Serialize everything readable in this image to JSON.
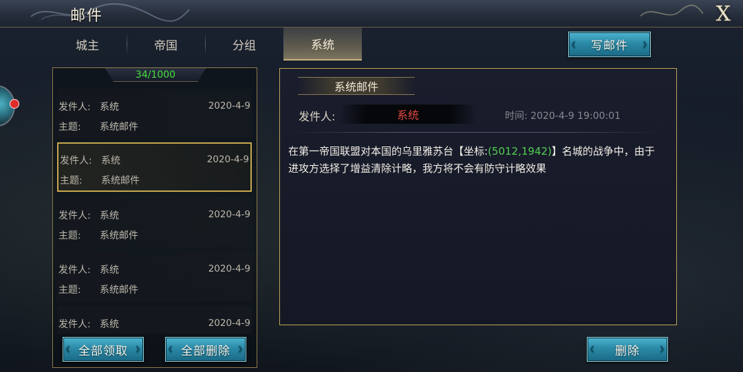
{
  "window": {
    "title": "邮件",
    "close_label": "X"
  },
  "tabs": [
    {
      "label": "城主",
      "active": false
    },
    {
      "label": "帝国",
      "active": false
    },
    {
      "label": "分组",
      "active": false
    },
    {
      "label": "系统",
      "active": true
    }
  ],
  "write_button": "写邮件",
  "mail_list": {
    "count": "34/1000",
    "sender_label": "发件人:",
    "subject_label": "主题:",
    "items": [
      {
        "sender": "系统",
        "subject": "系统邮件",
        "date": "2020-4-9"
      },
      {
        "sender": "系统",
        "subject": "系统邮件",
        "date": "2020-4-9",
        "selected": true
      },
      {
        "sender": "系统",
        "subject": "系统邮件",
        "date": "2020-4-9"
      },
      {
        "sender": "系统",
        "subject": "系统邮件",
        "date": "2020-4-9"
      },
      {
        "sender": "系统",
        "subject": "",
        "date": "2020-4-9"
      }
    ],
    "claim_all": "全部领取",
    "delete_all": "全部删除"
  },
  "detail": {
    "header": "系统邮件",
    "sender_label": "发件人:",
    "sender": "系统",
    "time": "时间: 2020-4-9  19:00:01",
    "body_before": "在第一帝国联盟对本国的乌里雅苏台【坐标:",
    "body_coord": "(5012,1942)",
    "body_after": "】名城的战争中，由于进攻方选择了增益清除计略，我方将不会有防守计略效果"
  },
  "delete_button": "删除",
  "colors": {
    "accent_gold": "#c7a94d",
    "count_green": "#44e03c",
    "sender_red": "#e2473e",
    "coord_green": "#53d052",
    "button_teal": "#2b8aa7"
  },
  "icons": [
    "close-icon",
    "avatar-icon",
    "notification-dot"
  ]
}
